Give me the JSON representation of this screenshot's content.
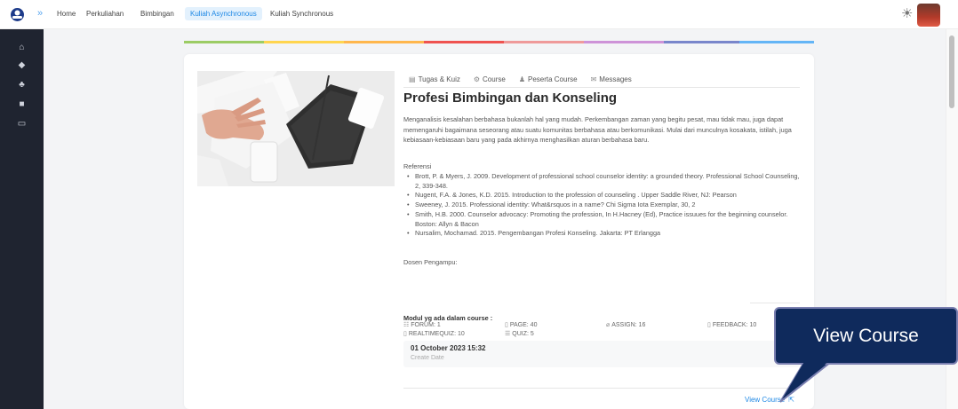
{
  "nav": {
    "links": [
      "Home",
      "Perkuliahan",
      "Bimbingan",
      "Kuliah Asynchronous",
      "Kuliah Synchronous"
    ],
    "active_index": 3
  },
  "sidebar": {
    "icons": [
      "home-icon",
      "graduation-cap-icon",
      "users-icon",
      "book-icon",
      "folder-icon"
    ]
  },
  "tabs": [
    {
      "label": "Tugas & Kuiz",
      "icon": "list-icon"
    },
    {
      "label": "Course",
      "icon": "gear-icon"
    },
    {
      "label": "Peserta Course",
      "icon": "users-icon"
    },
    {
      "label": "Messages",
      "icon": "mail-icon"
    }
  ],
  "course": {
    "title": "Profesi Bimbingan dan Konseling",
    "description": "Menganalisis kesalahan berbahasa bukanlah hal yang mudah. Perkembangan zaman yang begitu pesat, mau tidak mau, juga dapat memengaruhi bagaimana seseorang atau suatu komunitas berbahasa atau berkomunikasi. Mulai dari munculnya kosakata, istilah, juga kebiasaan-kebiasaan baru yang pada akhirnya menghasilkan aturan berbahasa baru.",
    "reference_label": "Referensi",
    "references": [
      "Brott, P. & Myers, J. 2009. Development of professional school counselor identity: a grounded theory. Professional School Counseling, 2, 339-348.",
      "Nugent, F.A. & Jones, K.D. 2015. Introduction to the profession of counseling . Upper Saddle River, NJ: Pearson",
      "Sweeney, J. 2015. Professional identity: What&rsquos in a name? Chi Sigma Iota Exemplar, 30, 2",
      "Smith, H.B. 2000. Counselor advocacy: Promoting the profession, In H.Hacney (Ed), Practice issuues for the beginning counselor. Boston: Allyn & Bacon",
      "Nursalim, Mochamad. 2015. Pengembangan Profesi Konseling. Jakarta: PT Erlangga"
    ],
    "dosen_label": "Dosen Pengampu:"
  },
  "modules": {
    "title": "Modul yg ada dalam course :",
    "forum": "FORUM: 1",
    "page": "PAGE: 40",
    "assign": "ASSIGN: 16",
    "feedback": "FEEDBACK: 10",
    "realtimequiz": "REALTIMEQUIZ: 10",
    "quiz": "QUIZ: 5"
  },
  "create": {
    "date": "01 October 2023 15:32",
    "label": "Create Date"
  },
  "view_course": "View Course",
  "callout": "View Course",
  "colors": {
    "accent": "#1e88e5",
    "sidebar": "#1f2430",
    "callout": "#0f2a5c"
  }
}
